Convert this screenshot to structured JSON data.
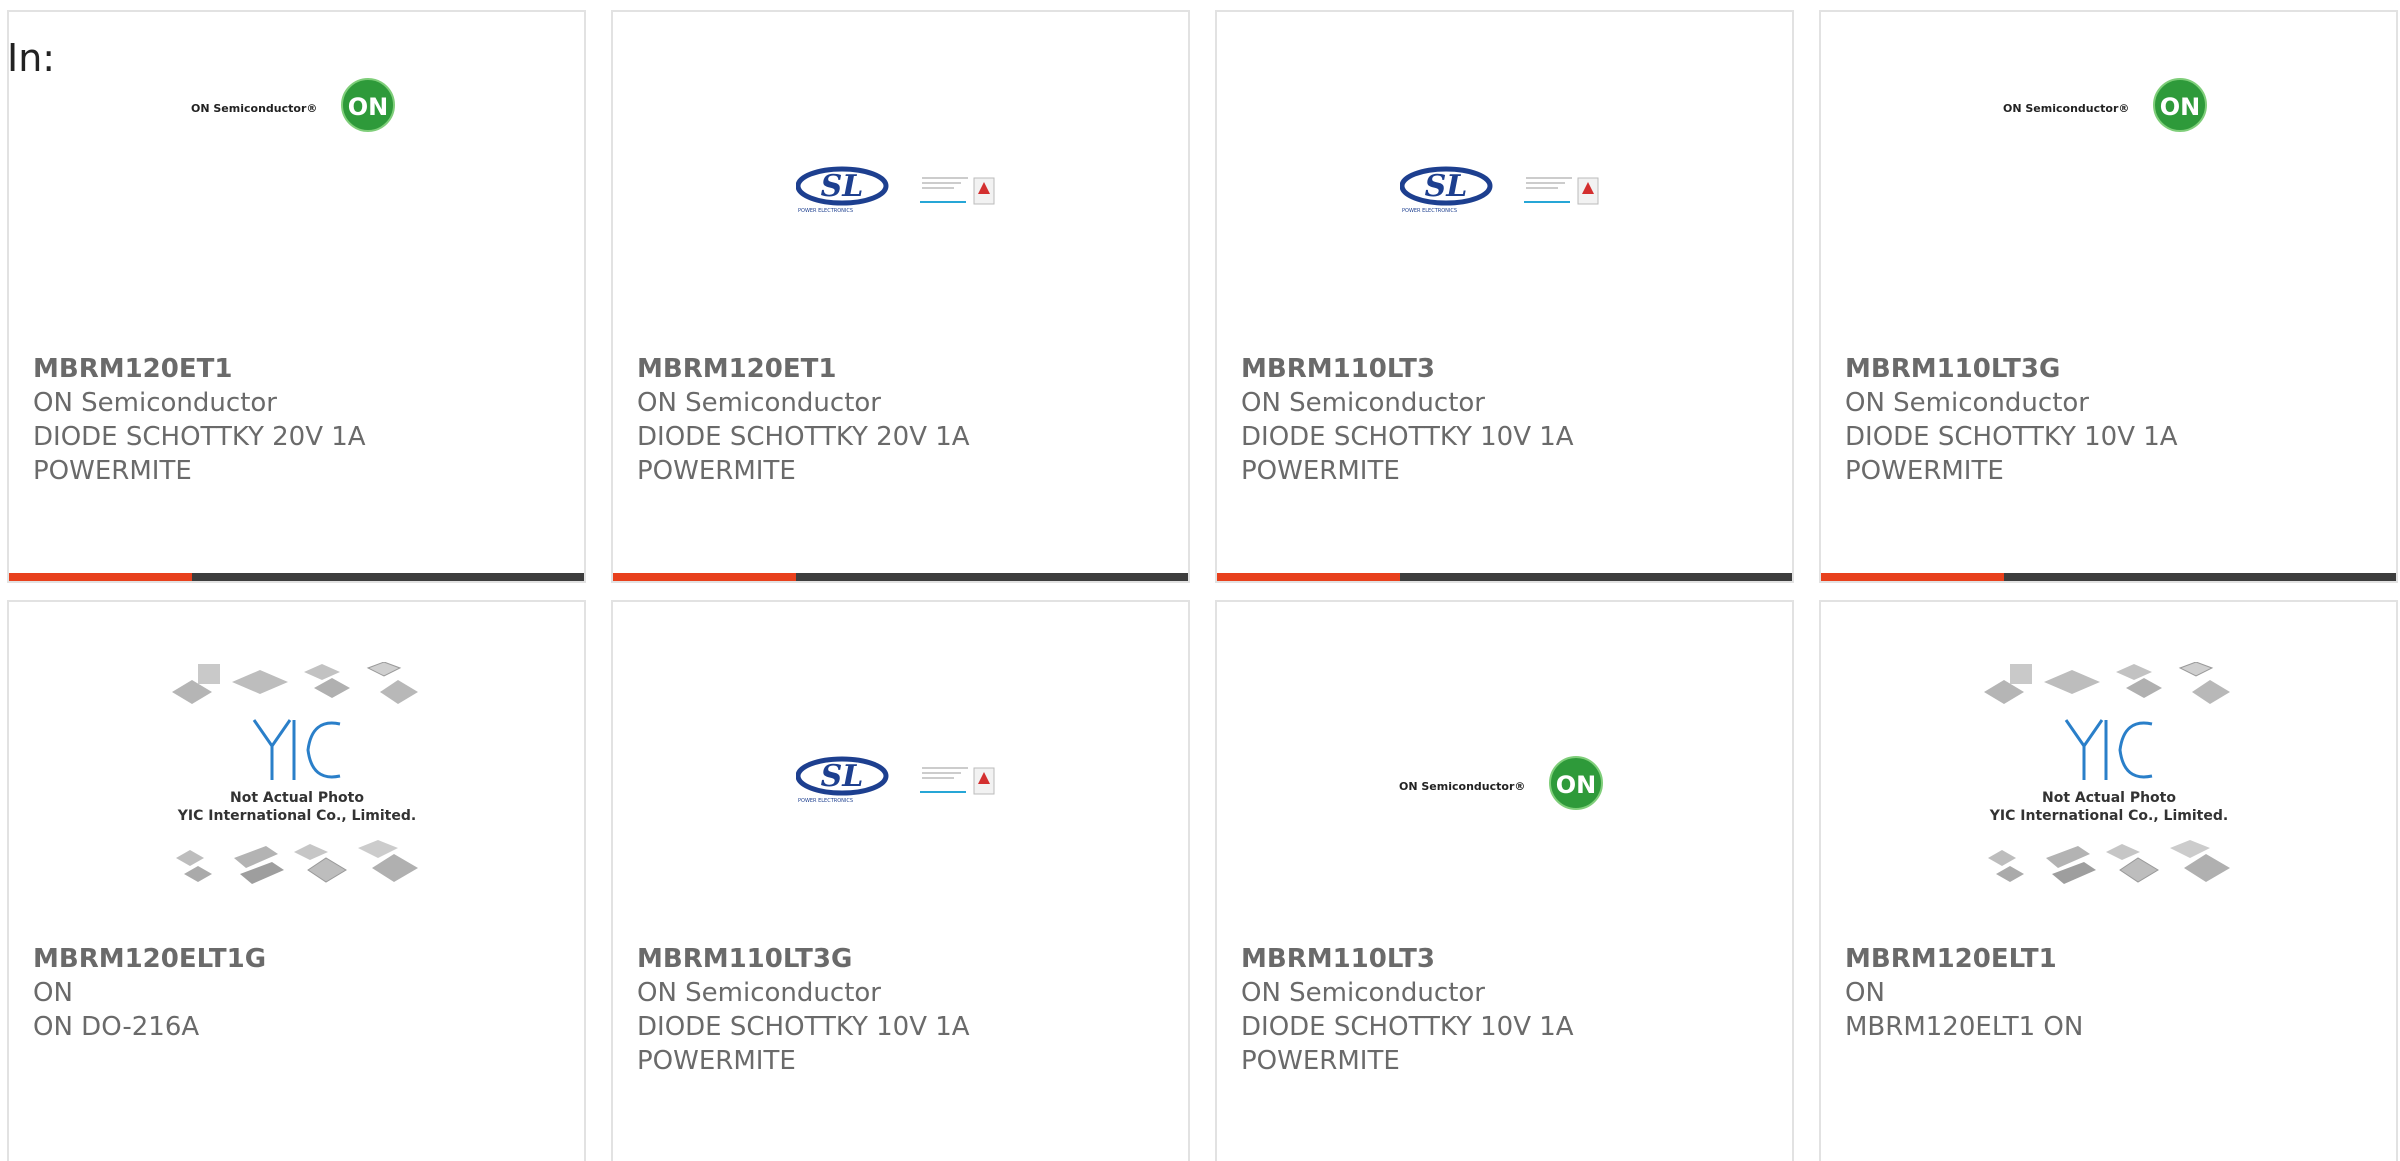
{
  "filter_label": "In:",
  "products": [
    {
      "part": "MBRM120ET1",
      "maker": "ON Semiconductor",
      "desc1": "DIODE SCHOTTKY 20V 1A",
      "desc2": "POWERMITE",
      "logo": "on-semiconductor-logo",
      "logo_text": "ON Semiconductor®",
      "logo_badge": "ON"
    },
    {
      "part": "MBRM120ET1",
      "maker": "ON Semiconductor",
      "desc1": "DIODE SCHOTTKY 20V 1A",
      "desc2": "POWERMITE",
      "logo": "sl-power-electronics-logo",
      "logo_text": "SL",
      "logo_sub": "POWER ELECTRONICS"
    },
    {
      "part": "MBRM110LT3",
      "maker": "ON Semiconductor",
      "desc1": "DIODE SCHOTTKY 10V 1A",
      "desc2": "POWERMITE",
      "logo": "sl-power-electronics-logo",
      "logo_text": "SL",
      "logo_sub": "POWER ELECTRONICS"
    },
    {
      "part": "MBRM110LT3G",
      "maker": "ON Semiconductor",
      "desc1": "DIODE SCHOTTKY 10V 1A",
      "desc2": "POWERMITE",
      "logo": "on-semiconductor-logo",
      "logo_text": "ON Semiconductor®",
      "logo_badge": "ON"
    },
    {
      "part": "MBRM120ELT1G",
      "maker": "ON",
      "desc1": "ON DO-216A",
      "desc2": "",
      "logo": "yic-placeholder-photo",
      "logo_line1": "Not Actual Photo",
      "logo_line2": "YIC International Co., Limited."
    },
    {
      "part": "MBRM110LT3G",
      "maker": "ON Semiconductor",
      "desc1": "DIODE SCHOTTKY 10V 1A",
      "desc2": "POWERMITE",
      "logo": "sl-power-electronics-logo",
      "logo_text": "SL",
      "logo_sub": "POWER ELECTRONICS"
    },
    {
      "part": "MBRM110LT3",
      "maker": "ON Semiconductor",
      "desc1": "DIODE SCHOTTKY 10V 1A",
      "desc2": "POWERMITE",
      "logo": "on-semiconductor-logo",
      "logo_text": "ON Semiconductor®",
      "logo_badge": "ON"
    },
    {
      "part": "MBRM120ELT1",
      "maker": "ON",
      "desc1": "MBRM120ELT1 ON",
      "desc2": "",
      "logo": "yic-placeholder-photo",
      "logo_line1": "Not Actual Photo",
      "logo_line2": "YIC International Co., Limited."
    }
  ],
  "colors": {
    "bar_dark": "#3d3d3d",
    "bar_accent": "#e8401c",
    "text": "#6a6a6a",
    "on_green": "#2e9a3a",
    "sl_blue": "#1d3f8f",
    "yic_blue": "#2a7fc9"
  }
}
